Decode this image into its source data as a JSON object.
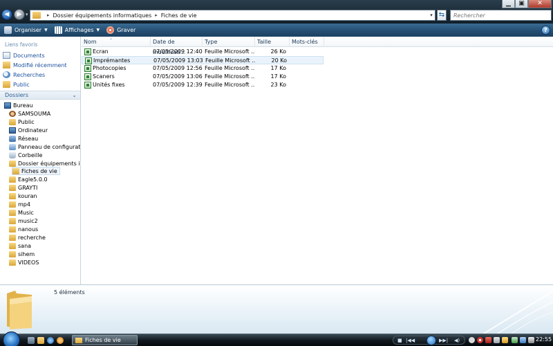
{
  "window": {
    "minimize": "▁",
    "maximize": "▣",
    "close": "✕"
  },
  "address": {
    "crumbs": [
      "Dossier équipements informatiques",
      "Fiches de vie"
    ],
    "search_placeholder": "Rechercher"
  },
  "toolbar": {
    "organize": "Organiser",
    "views": "Affichages",
    "burn": "Graver",
    "help": "?"
  },
  "nav": {
    "favorites_title": "Liens favoris",
    "favorites": [
      {
        "label": "Documents",
        "icon": "documents-icon"
      },
      {
        "label": "Modifié récemment",
        "icon": "recent-icon"
      },
      {
        "label": "Recherches",
        "icon": "searches-icon"
      },
      {
        "label": "Public",
        "icon": "public-folder-icon"
      }
    ],
    "folders_title": "Dossiers",
    "tree": [
      {
        "label": "Bureau",
        "icon": "desktop-icon"
      },
      {
        "label": "SAMSOUMA",
        "icon": "user-folder-icon"
      },
      {
        "label": "Public",
        "icon": "folder-icon"
      },
      {
        "label": "Ordinateur",
        "icon": "computer-icon"
      },
      {
        "label": "Réseau",
        "icon": "network-icon"
      },
      {
        "label": "Panneau de configuration",
        "icon": "control-panel-icon"
      },
      {
        "label": "Corbeille",
        "icon": "recycle-bin-icon"
      },
      {
        "label": "Dossier équipements inforr",
        "icon": "folder-icon"
      },
      {
        "label": "Fiches de vie",
        "icon": "folder-icon"
      },
      {
        "label": "Eagle5.0.0",
        "icon": "folder-icon"
      },
      {
        "label": "GRAYTI",
        "icon": "folder-icon"
      },
      {
        "label": "kouran",
        "icon": "folder-icon"
      },
      {
        "label": "mp4",
        "icon": "folder-icon"
      },
      {
        "label": "Music",
        "icon": "folder-icon"
      },
      {
        "label": "music2",
        "icon": "folder-icon"
      },
      {
        "label": "nanous",
        "icon": "folder-icon"
      },
      {
        "label": "recherche",
        "icon": "folder-icon"
      },
      {
        "label": "sana",
        "icon": "folder-icon"
      },
      {
        "label": "sihem",
        "icon": "folder-icon"
      },
      {
        "label": "VIDEOS",
        "icon": "folder-icon"
      }
    ]
  },
  "files": {
    "columns": [
      "Nom",
      "Date de modificati...",
      "Type",
      "Taille",
      "Mots-clés"
    ],
    "rows": [
      {
        "name": "Ecran",
        "date": "07/05/2009 12:40",
        "type": "Feuille Microsoft ...",
        "size": "26 Ko"
      },
      {
        "name": "Imprémantes",
        "date": "07/05/2009 13:03",
        "type": "Feuille Microsoft ...",
        "size": "20 Ko"
      },
      {
        "name": "Photocopies",
        "date": "07/05/2009 12:56",
        "type": "Feuille Microsoft ...",
        "size": "17 Ko"
      },
      {
        "name": "Scaners",
        "date": "07/05/2009 13:06",
        "type": "Feuille Microsoft ...",
        "size": "17 Ko"
      },
      {
        "name": "Unités fixes",
        "date": "07/05/2009 12:39",
        "type": "Feuille Microsoft ...",
        "size": "23 Ko"
      }
    ]
  },
  "details": {
    "count": "5 éléments"
  },
  "taskbar": {
    "task_label": "Fiches de vie",
    "clock": "22:55"
  },
  "colors": {
    "toolbar": "#254f73",
    "link": "#1a4f9c",
    "accent": "#2466b3"
  }
}
